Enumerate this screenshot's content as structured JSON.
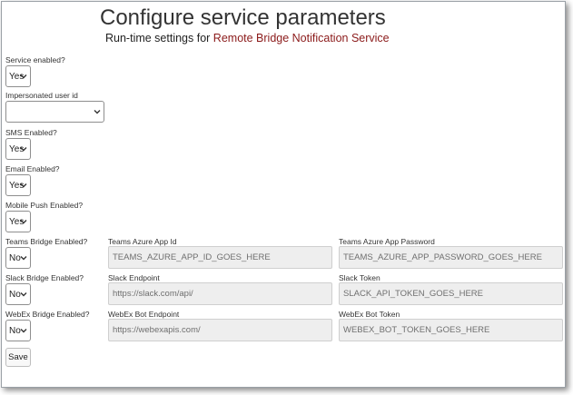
{
  "header": {
    "title": "Configure service parameters",
    "subtitle_prefix": "Run-time settings for ",
    "subtitle_service": "Remote Bridge Notification Service"
  },
  "form": {
    "service_enabled": {
      "label": "Service enabled?",
      "value": "Yes"
    },
    "impersonated_user": {
      "label": "Impersonated user id",
      "value": ""
    },
    "sms_enabled": {
      "label": "SMS Enabled?",
      "value": "Yes"
    },
    "email_enabled": {
      "label": "Email Enabled?",
      "value": "Yes"
    },
    "mobile_push_enabled": {
      "label": "Mobile Push Enabled?",
      "value": "Yes"
    },
    "teams": {
      "label": "Teams Bridge Enabled?",
      "value": "No",
      "app_id_label": "Teams Azure App Id",
      "app_id_placeholder": "TEAMS_AZURE_APP_ID_GOES_HERE",
      "password_label": "Teams Azure App Password",
      "password_placeholder": "TEAMS_AZURE_APP_PASSWORD_GOES_HERE"
    },
    "slack": {
      "label": "Slack Bridge Enabled?",
      "value": "No",
      "endpoint_label": "Slack Endpoint",
      "endpoint_placeholder": "https://slack.com/api/",
      "token_label": "Slack Token",
      "token_placeholder": "SLACK_API_TOKEN_GOES_HERE"
    },
    "webex": {
      "label": "WebEx Bridge Enabled?",
      "value": "No",
      "endpoint_label": "WebEx Bot Endpoint",
      "endpoint_placeholder": "https://webexapis.com/",
      "token_label": "WebEx Bot Token",
      "token_placeholder": "WEBEX_BOT_TOKEN_GOES_HERE"
    },
    "save_label": "Save"
  },
  "colors": {
    "accent": "#8b1a1a",
    "field_bg": "#eeeeee",
    "placeholder_text": "#6f6f6f"
  }
}
